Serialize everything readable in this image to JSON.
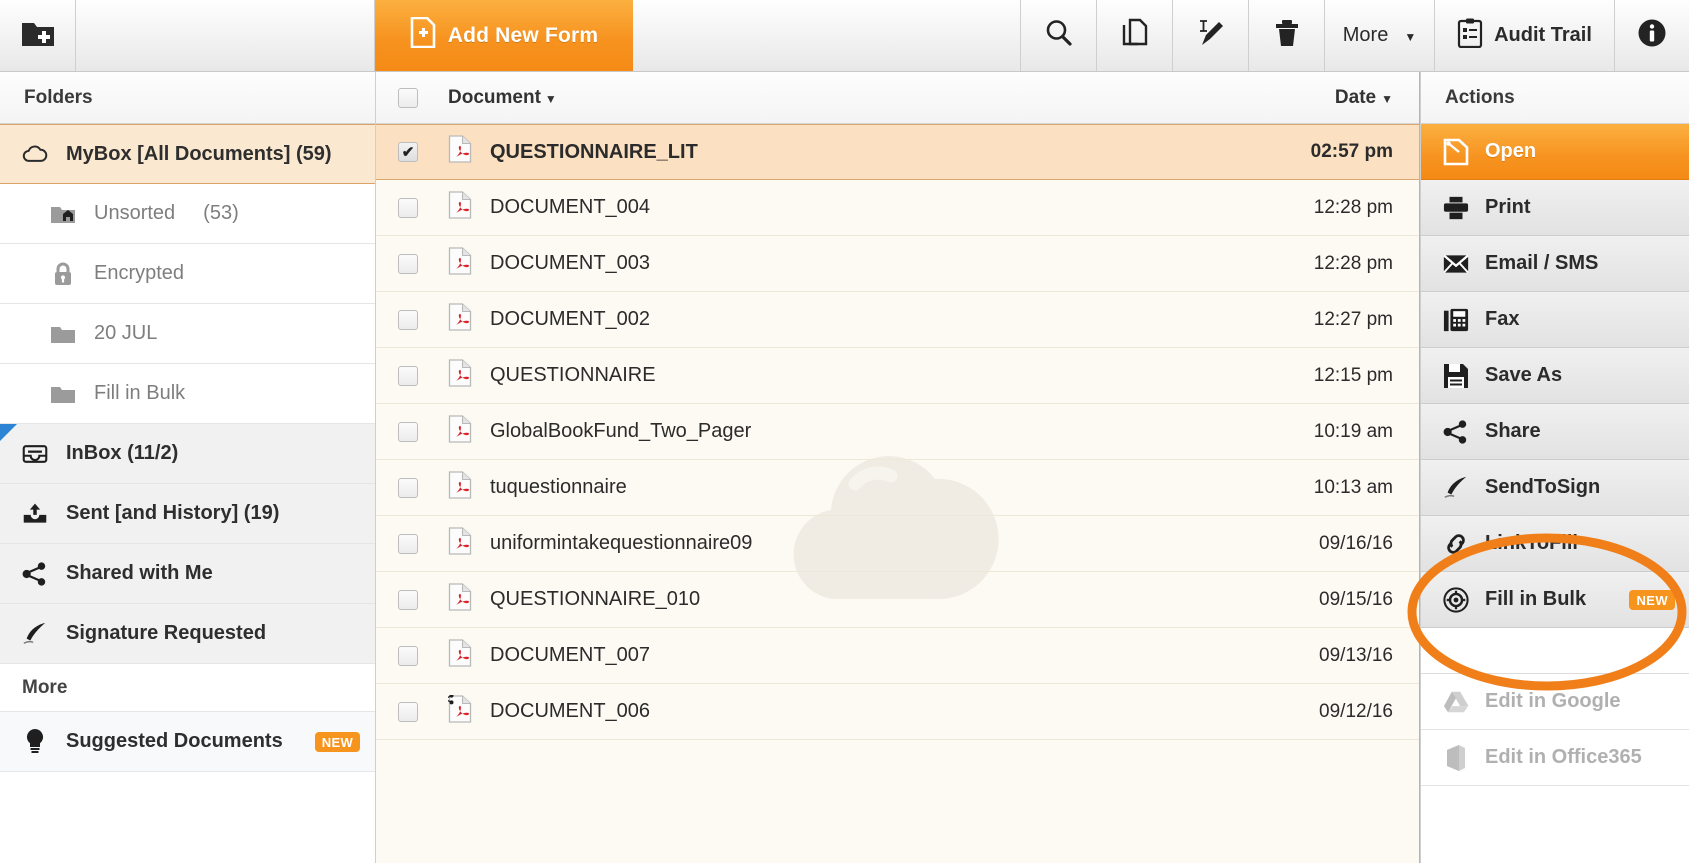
{
  "toolbar": {
    "new_folder_icon": "new-folder-icon",
    "add_new_form_label": "Add New Form",
    "search_icon": "search-icon",
    "copy_icon": "copy-icon",
    "rename_icon": "rename-pencil-icon",
    "delete_icon": "trash-icon",
    "more_label": "More",
    "more_caret": "▼",
    "audit_trail_label": "Audit Trail",
    "info_icon": "info-icon"
  },
  "sidebar": {
    "header": "Folders",
    "more_label": "More",
    "items": [
      {
        "label": "MyBox [All Documents] (59)",
        "icon": "cloud-icon",
        "state": "selected"
      },
      {
        "label": "Unsorted",
        "count": "(53)",
        "icon": "home-folder-icon",
        "state": "sub"
      },
      {
        "label": "Encrypted",
        "count": "",
        "icon": "lock-icon",
        "state": "sub"
      },
      {
        "label": "20 JUL",
        "count": "",
        "icon": "folder-icon",
        "state": "sub"
      },
      {
        "label": "Fill in Bulk",
        "count": "",
        "icon": "folder-icon",
        "state": "sub"
      },
      {
        "label": "InBox (11/2)",
        "icon": "inbox-icon",
        "state": "grey-active"
      },
      {
        "label": "Sent [and History] (19)",
        "icon": "sent-icon",
        "state": "grey"
      },
      {
        "label": "Shared with Me",
        "icon": "share-icon",
        "state": "grey"
      },
      {
        "label": "Signature Requested",
        "icon": "quill-icon",
        "state": "grey"
      }
    ],
    "suggested": {
      "label": "Suggested Documents",
      "icon": "lightbulb-icon",
      "badge": "NEW"
    }
  },
  "documents": {
    "columns": {
      "document": "Document",
      "date": "Date",
      "sort_caret": "▼"
    },
    "select_all_checked": false,
    "rows": [
      {
        "name": "QUESTIONNAIRE_LIT",
        "date": "02:57 pm",
        "checked": true,
        "selected": true,
        "icon": "pdf-icon"
      },
      {
        "name": "DOCUMENT_004",
        "date": "12:28 pm",
        "checked": false,
        "selected": false,
        "icon": "pdf-icon"
      },
      {
        "name": "DOCUMENT_003",
        "date": "12:28 pm",
        "checked": false,
        "selected": false,
        "icon": "pdf-icon"
      },
      {
        "name": "DOCUMENT_002",
        "date": "12:27 pm",
        "checked": false,
        "selected": false,
        "icon": "pdf-icon"
      },
      {
        "name": "QUESTIONNAIRE",
        "date": "12:15 pm",
        "checked": false,
        "selected": false,
        "icon": "pdf-icon"
      },
      {
        "name": "GlobalBookFund_Two_Pager",
        "date": "10:19 am",
        "checked": false,
        "selected": false,
        "icon": "pdf-icon"
      },
      {
        "name": "tuquestionnaire",
        "date": "10:13 am",
        "checked": false,
        "selected": false,
        "icon": "pdf-icon"
      },
      {
        "name": "uniformintakequestionnaire09",
        "date": "09/16/16",
        "checked": false,
        "selected": false,
        "icon": "pdf-icon"
      },
      {
        "name": "QUESTIONNAIRE_010",
        "date": "09/15/16",
        "checked": false,
        "selected": false,
        "icon": "pdf-icon"
      },
      {
        "name": "DOCUMENT_007",
        "date": "09/13/16",
        "checked": false,
        "selected": false,
        "icon": "pdf-icon"
      },
      {
        "name": "DOCUMENT_006",
        "date": "09/12/16",
        "checked": false,
        "selected": false,
        "icon": "pdf-shared-icon"
      }
    ],
    "watermark_icon": "cloud-watermark"
  },
  "actions": {
    "header": "Actions",
    "items": [
      {
        "label": "Open",
        "icon": "open-document-icon",
        "state": "primary"
      },
      {
        "label": "Print",
        "icon": "printer-icon",
        "state": "normal"
      },
      {
        "label": "Email / SMS",
        "icon": "envelope-icon",
        "state": "normal"
      },
      {
        "label": "Fax",
        "icon": "fax-icon",
        "state": "normal"
      },
      {
        "label": "Save As",
        "icon": "floppy-disk-icon",
        "state": "normal"
      },
      {
        "label": "Share",
        "icon": "share-icon",
        "state": "normal"
      },
      {
        "label": "SendToSign",
        "icon": "quill-icon",
        "state": "normal"
      },
      {
        "label": "LinkToFill",
        "icon": "link-icon",
        "state": "normal"
      },
      {
        "label": "Fill in Bulk",
        "icon": "bulk-gear-icon",
        "state": "normal",
        "badge": "NEW"
      },
      {
        "label": "Edit in Google",
        "icon": "google-drive-icon",
        "state": "disabled"
      },
      {
        "label": "Edit in Office365",
        "icon": "office365-icon",
        "state": "disabled"
      }
    ]
  },
  "annotation": {
    "type": "ellipse-highlight",
    "color": "#F07F1A",
    "target": "Fill in Bulk"
  },
  "colors": {
    "accent": "#F7941E",
    "accent_dark": "#F07F1A",
    "selected_row": "#FBE0C1",
    "list_bg": "#FDFAF3",
    "badge": "#F7941E"
  }
}
